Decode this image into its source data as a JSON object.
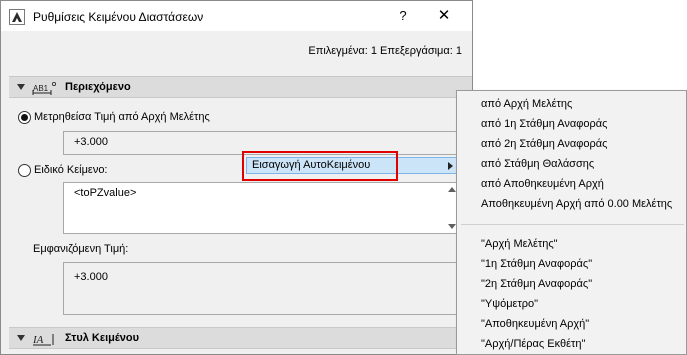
{
  "window": {
    "title": "Ρυθμίσεις Κειμένου Διαστάσεων",
    "help_label": "?",
    "close_label": "✕"
  },
  "selection_info": "Επιλεγμένα: 1 Επεξεργάσιμα: 1",
  "content_section": {
    "title": "Περιεχόμενο",
    "icon_text": "AB1",
    "measured_value_label": "Μετρηθείσα Τιμή από Αρχή Μελέτης",
    "measured_value": "+3.000",
    "measured_selected": true,
    "custom_text_label": "Ειδικό Κείμενο:",
    "custom_text_value": "<toPZvalue>",
    "insert_autotext_label": "Εισαγωγή ΑυτοΚειμένου",
    "displayed_value_label": "Εμφανιζόμενη Τιμή:",
    "displayed_value": "+3.000"
  },
  "text_style_section": {
    "title": "Στυλ Κειμένου",
    "icon_text": "IA"
  },
  "autotext_menu": {
    "group1": [
      "από Αρχή Μελέτης",
      "από 1η Στάθμη Αναφοράς",
      "από 2η Στάθμη Αναφοράς",
      "από Στάθμη Θαλάσσης",
      "από Αποθηκευμένη Αρχή",
      "Αποθηκευμένη Αρχή από 0.00 Μελέτης"
    ],
    "group2": [
      "\"Αρχή Μελέτης\"",
      "\"1η Στάθμη Αναφοράς\"",
      "\"2η Στάθμη Αναφοράς\"",
      "\"Υψόμετρο\"",
      "\"Αποθηκευμένη Αρχή\"",
      "\"Αρχή/Πέρας Εκθέτη\""
    ]
  },
  "colors": {
    "dialog_bg": "#f0f0f0",
    "section_header_bg": "#dcdcdc",
    "highlight_border": "#e00000",
    "menu_hover_bg": "#cce4f7"
  }
}
